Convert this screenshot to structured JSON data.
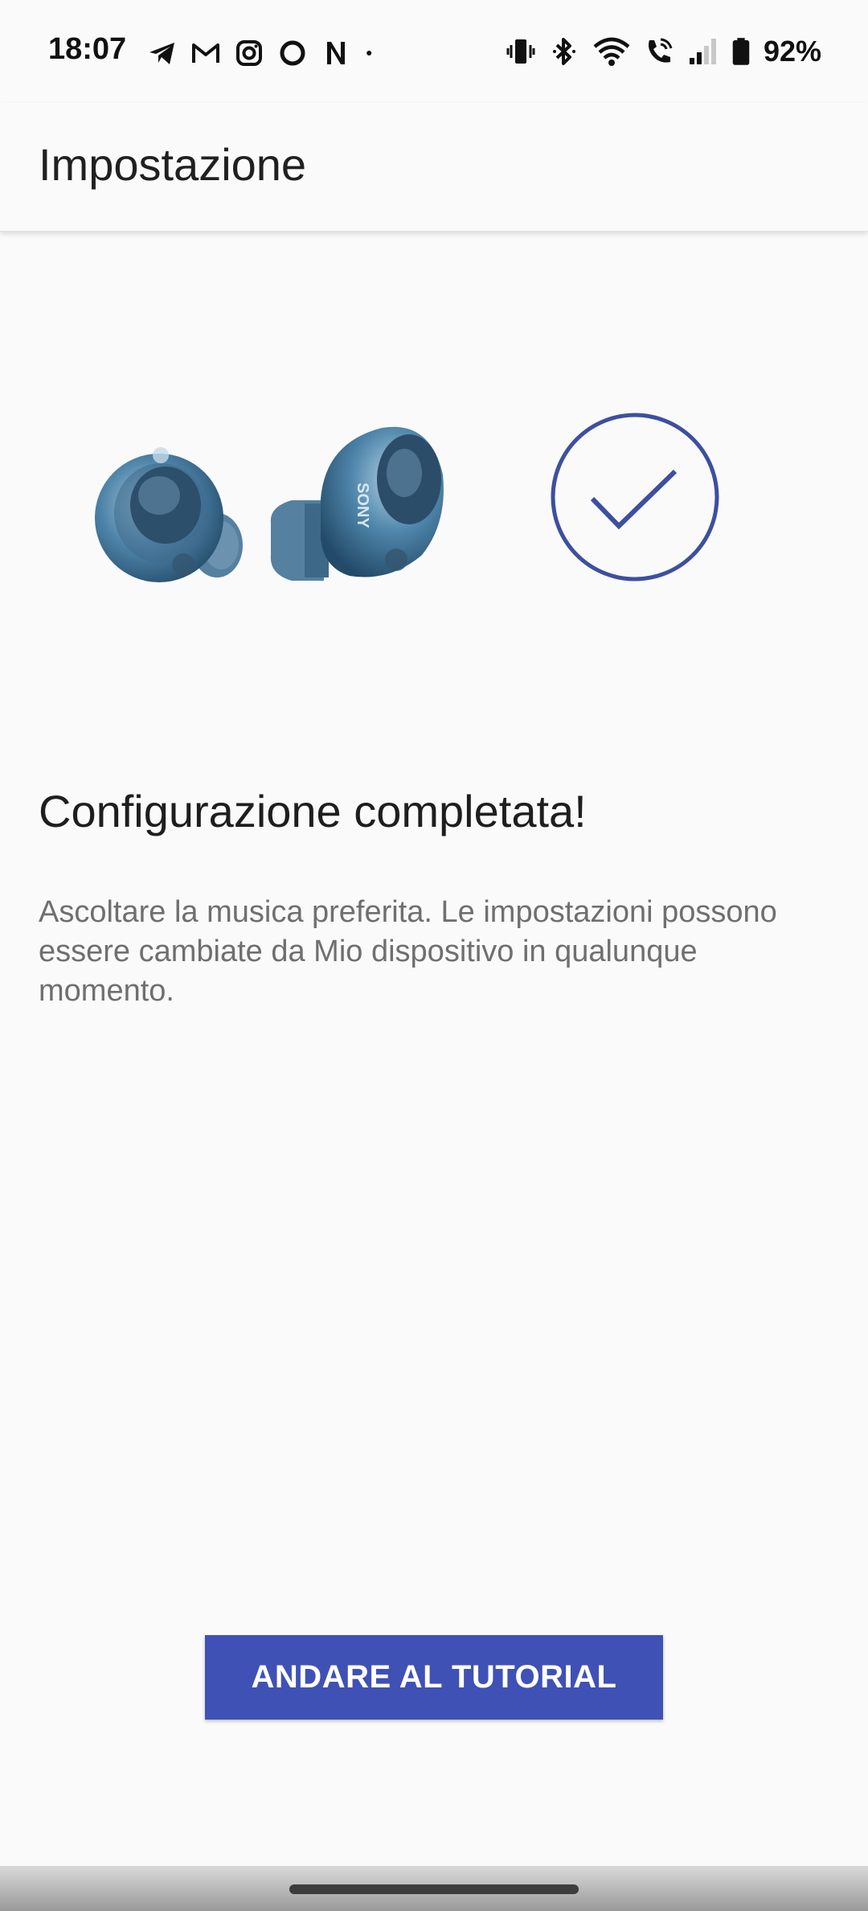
{
  "status_bar": {
    "time": "18:07",
    "battery_percent": "92%",
    "left_icons": [
      "telegram-icon",
      "gmail-icon",
      "instagram-icon",
      "circle-app-icon",
      "netflix-icon",
      "dot-icon"
    ],
    "right_icons": [
      "vibrate-icon",
      "bluetooth-icon",
      "wifi-icon",
      "wifi-call-icon",
      "signal-icon",
      "battery-icon"
    ]
  },
  "app_bar": {
    "title": "Impostazione"
  },
  "illustration": {
    "icons": [
      "earbud-left-image",
      "earbud-right-image",
      "check-circle-icon"
    ],
    "brand_text": "SONY"
  },
  "content": {
    "headline": "Configurazione completata!",
    "description": "Ascoltare la musica preferita. Le impostazioni possono essere cambiate da Mio dispositivo in qualunque momento."
  },
  "actions": {
    "tutorial_button": "ANDARE AL TUTORIAL"
  },
  "colors": {
    "accent": "#3f51b5",
    "check_stroke": "#3d4f9f",
    "background": "#fafafa",
    "earbud_blue": "#4a7fa4"
  }
}
